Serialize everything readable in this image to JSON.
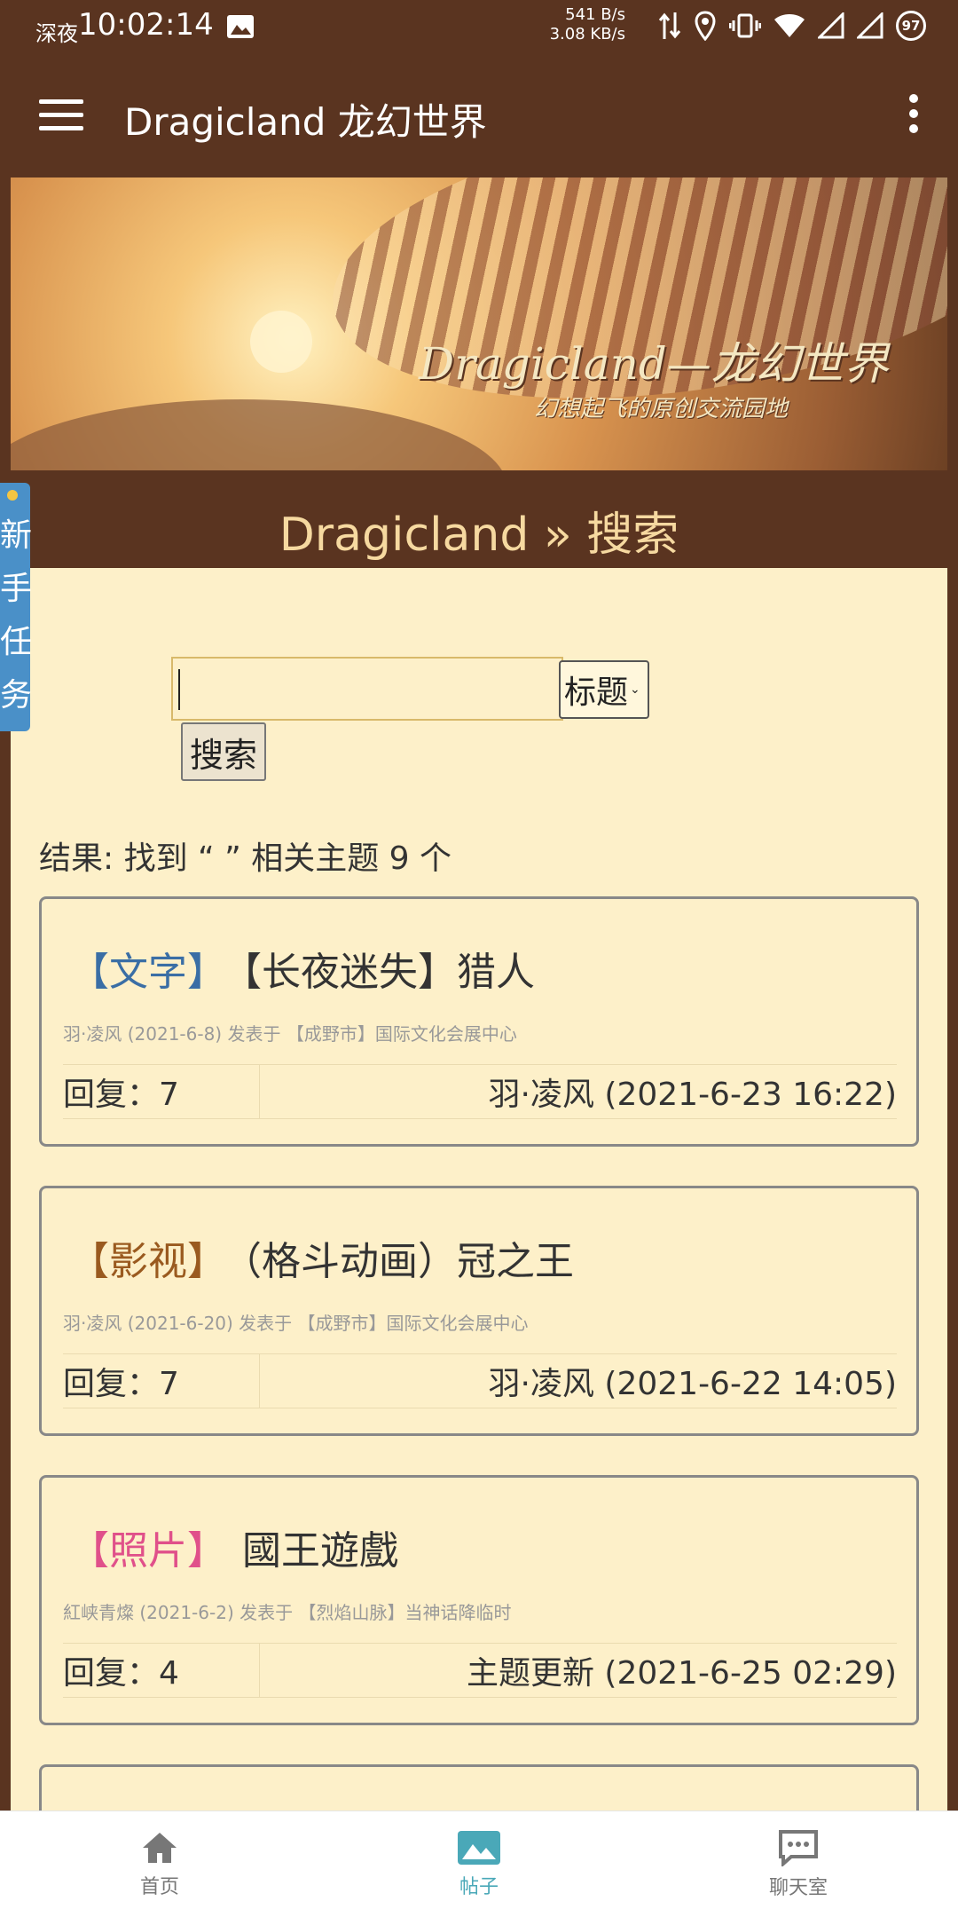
{
  "status_bar": {
    "time_label": "深夜",
    "time": "10:02:14",
    "net_up": "541 B/s",
    "net_down": "3.08 KB/s",
    "battery": "97"
  },
  "app_bar": {
    "title": "Dragicland 龙幻世界"
  },
  "banner": {
    "logo": "Dragicland—龙幻世界",
    "slogan": "幻想起飞的原创交流园地"
  },
  "side_tab": {
    "label_chars": [
      "新",
      "手",
      "任",
      "务"
    ]
  },
  "breadcrumb": "Dragicland » 搜索",
  "search": {
    "input_value": "",
    "type_selected": "标题",
    "button_label": "搜索"
  },
  "result_summary": "结果: 找到 “ ” 相关主题 9 个",
  "threads": [
    {
      "tag": "【文字】",
      "tag_color": "#3a6ea5",
      "title": "【长夜迷失】猎人",
      "meta": "羽·凌风 (2021-6-8) 发表于 【成野市】国际文化会展中心",
      "replies": "回复：7",
      "last": "羽·凌风 (2021-6-23 16:22)"
    },
    {
      "tag": "【影视】",
      "tag_color": "#9a5a1f",
      "title": "（格斗动画）冠之王",
      "meta": "羽·凌风 (2021-6-20) 发表于 【成野市】国际文化会展中心",
      "replies": "回复：7",
      "last": "羽·凌风 (2021-6-22 14:05)"
    },
    {
      "tag": "【照片】",
      "tag_color": "#e0508a",
      "title": "國王遊戲",
      "meta": "紅峡青燦 (2021-6-2) 发表于 【烈焰山脉】当神话降临时",
      "replies": "回复：4",
      "last": "主题更新 (2021-6-25 02:29)"
    }
  ],
  "bottom_nav": [
    {
      "label": "首页",
      "icon": "home-icon",
      "active": false
    },
    {
      "label": "帖子",
      "icon": "image-icon",
      "active": true
    },
    {
      "label": "聊天室",
      "icon": "chat-icon",
      "active": false
    }
  ]
}
